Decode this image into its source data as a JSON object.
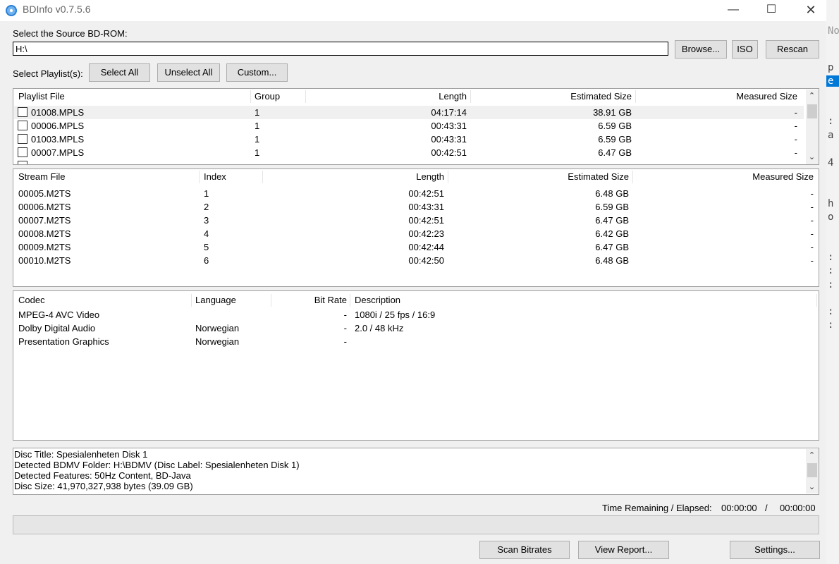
{
  "window": {
    "title": "BDInfo v0.7.5.6",
    "controls": {
      "minimize": "—",
      "maximize": "☐",
      "close": "✕"
    }
  },
  "source": {
    "label": "Select the Source BD-ROM:",
    "value": "H:\\",
    "browse": "Browse...",
    "iso": "ISO",
    "rescan": "Rescan"
  },
  "playlist_select": {
    "label": "Select Playlist(s):",
    "select_all": "Select All",
    "unselect_all": "Unselect All",
    "custom": "Custom..."
  },
  "playlists": {
    "headers": [
      "Playlist File",
      "Group",
      "Length",
      "Estimated Size",
      "Measured Size"
    ],
    "rows": [
      {
        "file": "01008.MPLS",
        "group": "1",
        "length": "04:17:14",
        "est": "38.91 GB",
        "meas": "-"
      },
      {
        "file": "00006.MPLS",
        "group": "1",
        "length": "00:43:31",
        "est": "6.59 GB",
        "meas": "-"
      },
      {
        "file": "01003.MPLS",
        "group": "1",
        "length": "00:43:31",
        "est": "6.59 GB",
        "meas": "-"
      },
      {
        "file": "00007.MPLS",
        "group": "1",
        "length": "00:42:51",
        "est": "6.47 GB",
        "meas": "-"
      }
    ]
  },
  "streams": {
    "headers": [
      "Stream File",
      "Index",
      "Length",
      "Estimated Size",
      "Measured Size"
    ],
    "rows": [
      {
        "file": "00005.M2TS",
        "index": "1",
        "length": "00:42:51",
        "est": "6.48 GB",
        "meas": "-"
      },
      {
        "file": "00006.M2TS",
        "index": "2",
        "length": "00:43:31",
        "est": "6.59 GB",
        "meas": "-"
      },
      {
        "file": "00007.M2TS",
        "index": "3",
        "length": "00:42:51",
        "est": "6.47 GB",
        "meas": "-"
      },
      {
        "file": "00008.M2TS",
        "index": "4",
        "length": "00:42:23",
        "est": "6.42 GB",
        "meas": "-"
      },
      {
        "file": "00009.M2TS",
        "index": "5",
        "length": "00:42:44",
        "est": "6.47 GB",
        "meas": "-"
      },
      {
        "file": "00010.M2TS",
        "index": "6",
        "length": "00:42:50",
        "est": "6.48 GB",
        "meas": "-"
      }
    ]
  },
  "codecs": {
    "headers": [
      "Codec",
      "Language",
      "Bit Rate",
      "Description"
    ],
    "rows": [
      {
        "codec": "MPEG-4 AVC Video",
        "lang": "",
        "bitrate": "-",
        "desc": "1080i / 25 fps / 16:9"
      },
      {
        "codec": "Dolby Digital Audio",
        "lang": "Norwegian",
        "bitrate": "-",
        "desc": "2.0 / 48 kHz"
      },
      {
        "codec": "Presentation Graphics",
        "lang": "Norwegian",
        "bitrate": "-",
        "desc": ""
      }
    ]
  },
  "info": {
    "lines": [
      "Disc Title: Spesialenheten Disk 1",
      "Detected BDMV Folder: H:\\BDMV (Disc Label: Spesialenheten Disk 1)",
      "Detected Features: 50Hz Content, BD-Java",
      "Disc Size: 41,970,327,938 bytes (39.09 GB)"
    ]
  },
  "timing": {
    "label": "Time Remaining / Elapsed:",
    "remaining": "00:00:00",
    "separator": "/",
    "elapsed": "00:00:00"
  },
  "progress": {
    "value": 0
  },
  "buttons": {
    "scan": "Scan Bitrates",
    "report": "View Report...",
    "settings": "Settings..."
  },
  "background_glyphs": [
    "No",
    "p",
    "e",
    ":",
    "a",
    "4",
    "h",
    "o",
    ":",
    ":",
    ":",
    ":",
    ":"
  ]
}
